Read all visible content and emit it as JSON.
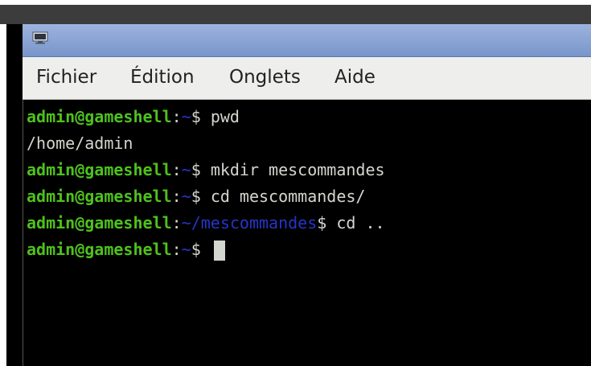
{
  "window": {
    "icon": "terminal-icon"
  },
  "menu": [
    {
      "label": "Fichier"
    },
    {
      "label": "Édition"
    },
    {
      "label": "Onglets"
    },
    {
      "label": "Aide"
    }
  ],
  "terminal": {
    "colors": {
      "user": "#4ec11d",
      "path": "#2535c8",
      "text": "#d3d7cf",
      "background": "#000000"
    },
    "lines": [
      {
        "user": "admin@gameshell",
        "sep": ":",
        "path": "~",
        "prompt": "$ ",
        "command": "pwd"
      },
      {
        "output": "/home/admin"
      },
      {
        "user": "admin@gameshell",
        "sep": ":",
        "path": "~",
        "prompt": "$ ",
        "command": "mkdir mescommandes"
      },
      {
        "user": "admin@gameshell",
        "sep": ":",
        "path": "~",
        "prompt": "$ ",
        "command": "cd mescommandes/"
      },
      {
        "user": "admin@gameshell",
        "sep": ":",
        "path": "~/mescommandes",
        "prompt": "$ ",
        "command": "cd .."
      },
      {
        "user": "admin@gameshell",
        "sep": ":",
        "path": "~",
        "prompt": "$ ",
        "command": ""
      }
    ]
  }
}
